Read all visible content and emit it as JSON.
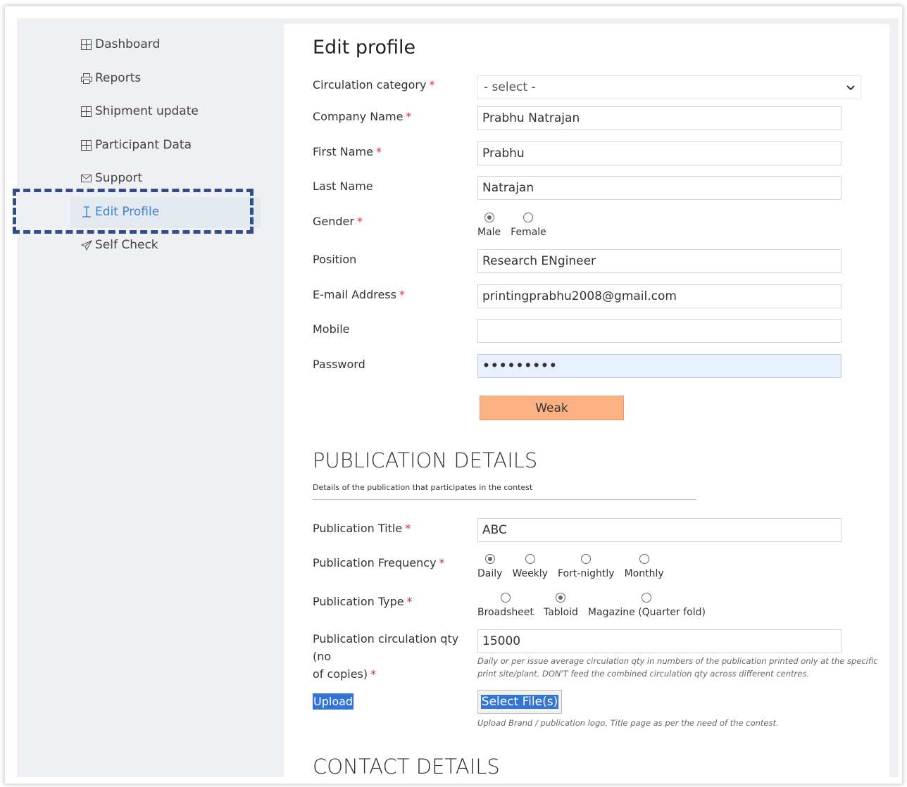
{
  "sidebar": {
    "items": [
      {
        "label": "Dashboard",
        "icon": "grid-icon"
      },
      {
        "label": "Reports",
        "icon": "printer-icon"
      },
      {
        "label": "Shipment update",
        "icon": "grid-icon"
      },
      {
        "label": "Participant Data",
        "icon": "grid-icon"
      },
      {
        "label": "Support",
        "icon": "envelope-icon"
      },
      {
        "label": "Edit Profile",
        "icon": "text-cursor-icon",
        "active": true
      },
      {
        "label": "Self Check",
        "icon": "paper-plane-icon"
      }
    ]
  },
  "form": {
    "title": "Edit profile",
    "required_mark": "*",
    "circulation_category": {
      "label": "Circulation category",
      "value": "- select -"
    },
    "company_name": {
      "label": "Company Name",
      "value": "Prabhu Natrajan"
    },
    "first_name": {
      "label": "First Name",
      "value": "Prabhu"
    },
    "last_name": {
      "label": "Last Name",
      "value": "Natrajan"
    },
    "gender": {
      "label": "Gender",
      "options": [
        "Male",
        "Female"
      ],
      "selected": "Male"
    },
    "position": {
      "label": "Position",
      "value": "Research ENgineer"
    },
    "email": {
      "label": "E-mail Address",
      "value": "printingprabhu2008@gmail.com"
    },
    "mobile": {
      "label": "Mobile",
      "value": ""
    },
    "password": {
      "label": "Password",
      "value": "•••••••••"
    },
    "strength": "Weak"
  },
  "publication": {
    "heading": "PUBLICATION DETAILS",
    "subheading": "Details of the publication that participates in the contest",
    "title": {
      "label": "Publication Title",
      "value": "ABC"
    },
    "frequency": {
      "label": "Publication Frequency",
      "options": [
        "Daily",
        "Weekly",
        "Fort-nightly",
        "Monthly"
      ],
      "selected": "Daily"
    },
    "type": {
      "label": "Publication Type",
      "options": [
        "Broadsheet",
        "Tabloid",
        "Magazine (Quarter fold)"
      ],
      "selected": "Tabloid"
    },
    "circulation": {
      "label_line1": "Publication circulation qty (no",
      "label_line2": "of copies)",
      "value": "15000",
      "help_line1": "Daily or per issue average circulation qty in numbers of the publication printed only at the specific",
      "help_line2": "print site/plant. DON'T feed the combined circulation qty across different centres."
    },
    "upload": {
      "label": "Upload",
      "button": "Select File(s)",
      "help": "Upload Brand / publication logo, Title page as per the need of the contest."
    }
  },
  "contact": {
    "heading": "CONTACT DETAILS"
  },
  "colors": {
    "accent": "#3a86d6",
    "weak": "#fbb182",
    "required": "#e02b2b",
    "highlight": "#2f4f8a"
  }
}
